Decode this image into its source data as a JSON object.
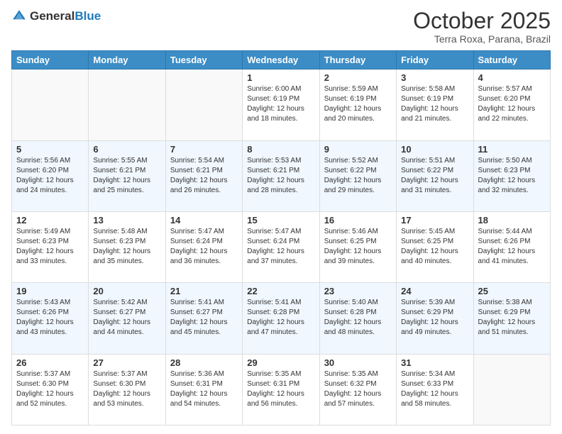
{
  "logo": {
    "general": "General",
    "blue": "Blue"
  },
  "title": "October 2025",
  "location": "Terra Roxa, Parana, Brazil",
  "days_of_week": [
    "Sunday",
    "Monday",
    "Tuesday",
    "Wednesday",
    "Thursday",
    "Friday",
    "Saturday"
  ],
  "weeks": [
    [
      {
        "day": "",
        "info": ""
      },
      {
        "day": "",
        "info": ""
      },
      {
        "day": "",
        "info": ""
      },
      {
        "day": "1",
        "info": "Sunrise: 6:00 AM\nSunset: 6:19 PM\nDaylight: 12 hours\nand 18 minutes."
      },
      {
        "day": "2",
        "info": "Sunrise: 5:59 AM\nSunset: 6:19 PM\nDaylight: 12 hours\nand 20 minutes."
      },
      {
        "day": "3",
        "info": "Sunrise: 5:58 AM\nSunset: 6:19 PM\nDaylight: 12 hours\nand 21 minutes."
      },
      {
        "day": "4",
        "info": "Sunrise: 5:57 AM\nSunset: 6:20 PM\nDaylight: 12 hours\nand 22 minutes."
      }
    ],
    [
      {
        "day": "5",
        "info": "Sunrise: 5:56 AM\nSunset: 6:20 PM\nDaylight: 12 hours\nand 24 minutes."
      },
      {
        "day": "6",
        "info": "Sunrise: 5:55 AM\nSunset: 6:21 PM\nDaylight: 12 hours\nand 25 minutes."
      },
      {
        "day": "7",
        "info": "Sunrise: 5:54 AM\nSunset: 6:21 PM\nDaylight: 12 hours\nand 26 minutes."
      },
      {
        "day": "8",
        "info": "Sunrise: 5:53 AM\nSunset: 6:21 PM\nDaylight: 12 hours\nand 28 minutes."
      },
      {
        "day": "9",
        "info": "Sunrise: 5:52 AM\nSunset: 6:22 PM\nDaylight: 12 hours\nand 29 minutes."
      },
      {
        "day": "10",
        "info": "Sunrise: 5:51 AM\nSunset: 6:22 PM\nDaylight: 12 hours\nand 31 minutes."
      },
      {
        "day": "11",
        "info": "Sunrise: 5:50 AM\nSunset: 6:23 PM\nDaylight: 12 hours\nand 32 minutes."
      }
    ],
    [
      {
        "day": "12",
        "info": "Sunrise: 5:49 AM\nSunset: 6:23 PM\nDaylight: 12 hours\nand 33 minutes."
      },
      {
        "day": "13",
        "info": "Sunrise: 5:48 AM\nSunset: 6:23 PM\nDaylight: 12 hours\nand 35 minutes."
      },
      {
        "day": "14",
        "info": "Sunrise: 5:47 AM\nSunset: 6:24 PM\nDaylight: 12 hours\nand 36 minutes."
      },
      {
        "day": "15",
        "info": "Sunrise: 5:47 AM\nSunset: 6:24 PM\nDaylight: 12 hours\nand 37 minutes."
      },
      {
        "day": "16",
        "info": "Sunrise: 5:46 AM\nSunset: 6:25 PM\nDaylight: 12 hours\nand 39 minutes."
      },
      {
        "day": "17",
        "info": "Sunrise: 5:45 AM\nSunset: 6:25 PM\nDaylight: 12 hours\nand 40 minutes."
      },
      {
        "day": "18",
        "info": "Sunrise: 5:44 AM\nSunset: 6:26 PM\nDaylight: 12 hours\nand 41 minutes."
      }
    ],
    [
      {
        "day": "19",
        "info": "Sunrise: 5:43 AM\nSunset: 6:26 PM\nDaylight: 12 hours\nand 43 minutes."
      },
      {
        "day": "20",
        "info": "Sunrise: 5:42 AM\nSunset: 6:27 PM\nDaylight: 12 hours\nand 44 minutes."
      },
      {
        "day": "21",
        "info": "Sunrise: 5:41 AM\nSunset: 6:27 PM\nDaylight: 12 hours\nand 45 minutes."
      },
      {
        "day": "22",
        "info": "Sunrise: 5:41 AM\nSunset: 6:28 PM\nDaylight: 12 hours\nand 47 minutes."
      },
      {
        "day": "23",
        "info": "Sunrise: 5:40 AM\nSunset: 6:28 PM\nDaylight: 12 hours\nand 48 minutes."
      },
      {
        "day": "24",
        "info": "Sunrise: 5:39 AM\nSunset: 6:29 PM\nDaylight: 12 hours\nand 49 minutes."
      },
      {
        "day": "25",
        "info": "Sunrise: 5:38 AM\nSunset: 6:29 PM\nDaylight: 12 hours\nand 51 minutes."
      }
    ],
    [
      {
        "day": "26",
        "info": "Sunrise: 5:37 AM\nSunset: 6:30 PM\nDaylight: 12 hours\nand 52 minutes."
      },
      {
        "day": "27",
        "info": "Sunrise: 5:37 AM\nSunset: 6:30 PM\nDaylight: 12 hours\nand 53 minutes."
      },
      {
        "day": "28",
        "info": "Sunrise: 5:36 AM\nSunset: 6:31 PM\nDaylight: 12 hours\nand 54 minutes."
      },
      {
        "day": "29",
        "info": "Sunrise: 5:35 AM\nSunset: 6:31 PM\nDaylight: 12 hours\nand 56 minutes."
      },
      {
        "day": "30",
        "info": "Sunrise: 5:35 AM\nSunset: 6:32 PM\nDaylight: 12 hours\nand 57 minutes."
      },
      {
        "day": "31",
        "info": "Sunrise: 5:34 AM\nSunset: 6:33 PM\nDaylight: 12 hours\nand 58 minutes."
      },
      {
        "day": "",
        "info": ""
      }
    ]
  ]
}
